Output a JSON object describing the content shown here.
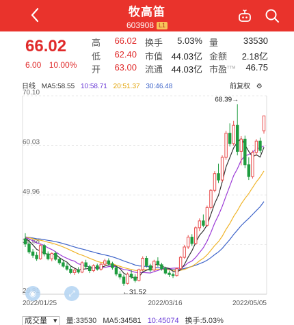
{
  "header": {
    "title": "牧高笛",
    "code": "603908",
    "badge": "L1",
    "colors": {
      "bg": "#e9332c"
    }
  },
  "quote": {
    "price": "66.02",
    "change": "6.00",
    "change_pct": "10.00%",
    "stats": [
      {
        "label": "高",
        "value": "66.02",
        "color": "red"
      },
      {
        "label": "换手",
        "value": "5.03%",
        "color": "dark"
      },
      {
        "label": "量",
        "value": "33530",
        "color": "dark"
      },
      {
        "label": "低",
        "value": "62.40",
        "color": "red"
      },
      {
        "label": "市值",
        "value": "44.03亿",
        "color": "dark"
      },
      {
        "label": "金额",
        "value": "2.18亿",
        "color": "dark"
      },
      {
        "label": "开",
        "value": "63.00",
        "color": "red"
      },
      {
        "label": "流通",
        "value": "44.03亿",
        "color": "dark"
      },
      {
        "label": "市盈TTM",
        "value": "46.75",
        "color": "dark"
      }
    ]
  },
  "chart_info": {
    "period": "日线",
    "ma5": "MA5:58.55",
    "ma10": "10:58.71",
    "ma20": "20:51.37",
    "ma30": "30:46.48",
    "adjust": "前复权"
  },
  "footer": {
    "volume_btn": "成交量",
    "vol": "量:33530",
    "ma5": "MA5:34581",
    "ma10": "10:45074",
    "turnover": "换手:5.03%"
  },
  "chart_data": {
    "type": "candlestick",
    "ylim": [
      29.81,
      70.1
    ],
    "y_ticks": [
      "70.10",
      "60.03",
      "49.96",
      "39.88",
      "29.81"
    ],
    "x_labels": [
      "2022/01/25",
      "2022/03/16",
      "2022/05/05"
    ],
    "annotations": {
      "high": "68.39",
      "low": "31.52"
    },
    "colors": {
      "up": "#e84a4a",
      "down": "#1e9c3f",
      "ma5": "#333333",
      "ma10": "#9b3ad6",
      "ma20": "#f0b429",
      "ma30": "#3e64c9"
    },
    "candles": [
      [
        41.0,
        42.2,
        39.4,
        40.0
      ],
      [
        40.0,
        40.6,
        38.0,
        38.4
      ],
      [
        38.4,
        39.0,
        37.2,
        37.7
      ],
      [
        37.7,
        38.4,
        36.6,
        37.0
      ],
      [
        37.0,
        40.0,
        36.8,
        39.7
      ],
      [
        39.7,
        40.0,
        37.5,
        38.0
      ],
      [
        38.0,
        38.5,
        36.7,
        37.0
      ],
      [
        37.0,
        38.3,
        36.5,
        38.1
      ],
      [
        38.1,
        38.5,
        36.6,
        36.9
      ],
      [
        36.9,
        37.2,
        35.8,
        36.2
      ],
      [
        36.2,
        36.7,
        35.2,
        35.5
      ],
      [
        35.5,
        36.1,
        34.6,
        34.9
      ],
      [
        34.9,
        35.5,
        33.9,
        34.2
      ],
      [
        34.2,
        35.0,
        33.7,
        34.7
      ],
      [
        34.7,
        35.3,
        34.0,
        34.3
      ],
      [
        34.3,
        36.5,
        34.1,
        36.2
      ],
      [
        36.2,
        36.8,
        35.0,
        35.4
      ],
      [
        35.4,
        35.8,
        34.1,
        34.6
      ],
      [
        34.6,
        35.9,
        34.3,
        35.6
      ],
      [
        35.6,
        36.0,
        34.6,
        34.9
      ],
      [
        34.9,
        36.2,
        34.6,
        35.9
      ],
      [
        35.9,
        37.0,
        35.5,
        36.6
      ],
      [
        36.6,
        37.1,
        35.6,
        36.0
      ],
      [
        36.0,
        36.4,
        34.8,
        35.2
      ],
      [
        35.2,
        35.6,
        33.5,
        33.9
      ],
      [
        33.9,
        34.5,
        32.8,
        33.3
      ],
      [
        33.3,
        33.8,
        31.5,
        32.0
      ],
      [
        32.0,
        34.2,
        31.8,
        33.9
      ],
      [
        33.9,
        34.7,
        32.9,
        33.3
      ],
      [
        33.3,
        33.9,
        32.2,
        32.6
      ],
      [
        32.6,
        35.0,
        32.4,
        34.8
      ],
      [
        34.8,
        37.5,
        34.5,
        37.1
      ],
      [
        37.1,
        37.6,
        35.2,
        35.6
      ],
      [
        35.6,
        36.0,
        34.3,
        34.7
      ],
      [
        34.7,
        36.8,
        34.5,
        36.5
      ],
      [
        36.5,
        37.3,
        35.4,
        35.8
      ],
      [
        35.8,
        36.2,
        34.6,
        35.0
      ],
      [
        35.0,
        35.4,
        33.8,
        34.1
      ],
      [
        34.1,
        34.6,
        33.3,
        33.8
      ],
      [
        33.8,
        34.2,
        33.1,
        33.6
      ],
      [
        33.6,
        35.2,
        33.4,
        35.0
      ],
      [
        35.0,
        37.6,
        34.8,
        37.3
      ],
      [
        37.3,
        39.8,
        37.0,
        39.4
      ],
      [
        39.4,
        41.8,
        39.0,
        41.4
      ],
      [
        41.4,
        42.0,
        39.6,
        40.1
      ],
      [
        40.1,
        43.6,
        39.9,
        43.3
      ],
      [
        43.3,
        45.2,
        42.6,
        44.7
      ],
      [
        44.7,
        46.0,
        43.4,
        43.8
      ],
      [
        43.8,
        47.8,
        43.5,
        47.4
      ],
      [
        47.4,
        51.2,
        47.0,
        50.9
      ],
      [
        50.9,
        54.8,
        50.5,
        54.3
      ],
      [
        54.3,
        56.3,
        52.4,
        53.0
      ],
      [
        53.0,
        58.0,
        52.6,
        57.6
      ],
      [
        57.6,
        63.0,
        57.1,
        62.5
      ],
      [
        62.5,
        64.5,
        59.8,
        60.4
      ],
      [
        60.4,
        65.0,
        60.0,
        64.1
      ],
      [
        64.1,
        68.39,
        58.0,
        58.8
      ],
      [
        58.8,
        61.9,
        56.0,
        61.3
      ],
      [
        61.3,
        62.0,
        55.4,
        56.1
      ],
      [
        56.1,
        57.6,
        53.0,
        53.7
      ],
      [
        53.7,
        59.0,
        53.3,
        58.6
      ],
      [
        58.6,
        61.3,
        57.9,
        60.9
      ],
      [
        60.9,
        61.6,
        58.4,
        59.0
      ],
      [
        63.0,
        66.02,
        62.4,
        66.02
      ]
    ]
  }
}
